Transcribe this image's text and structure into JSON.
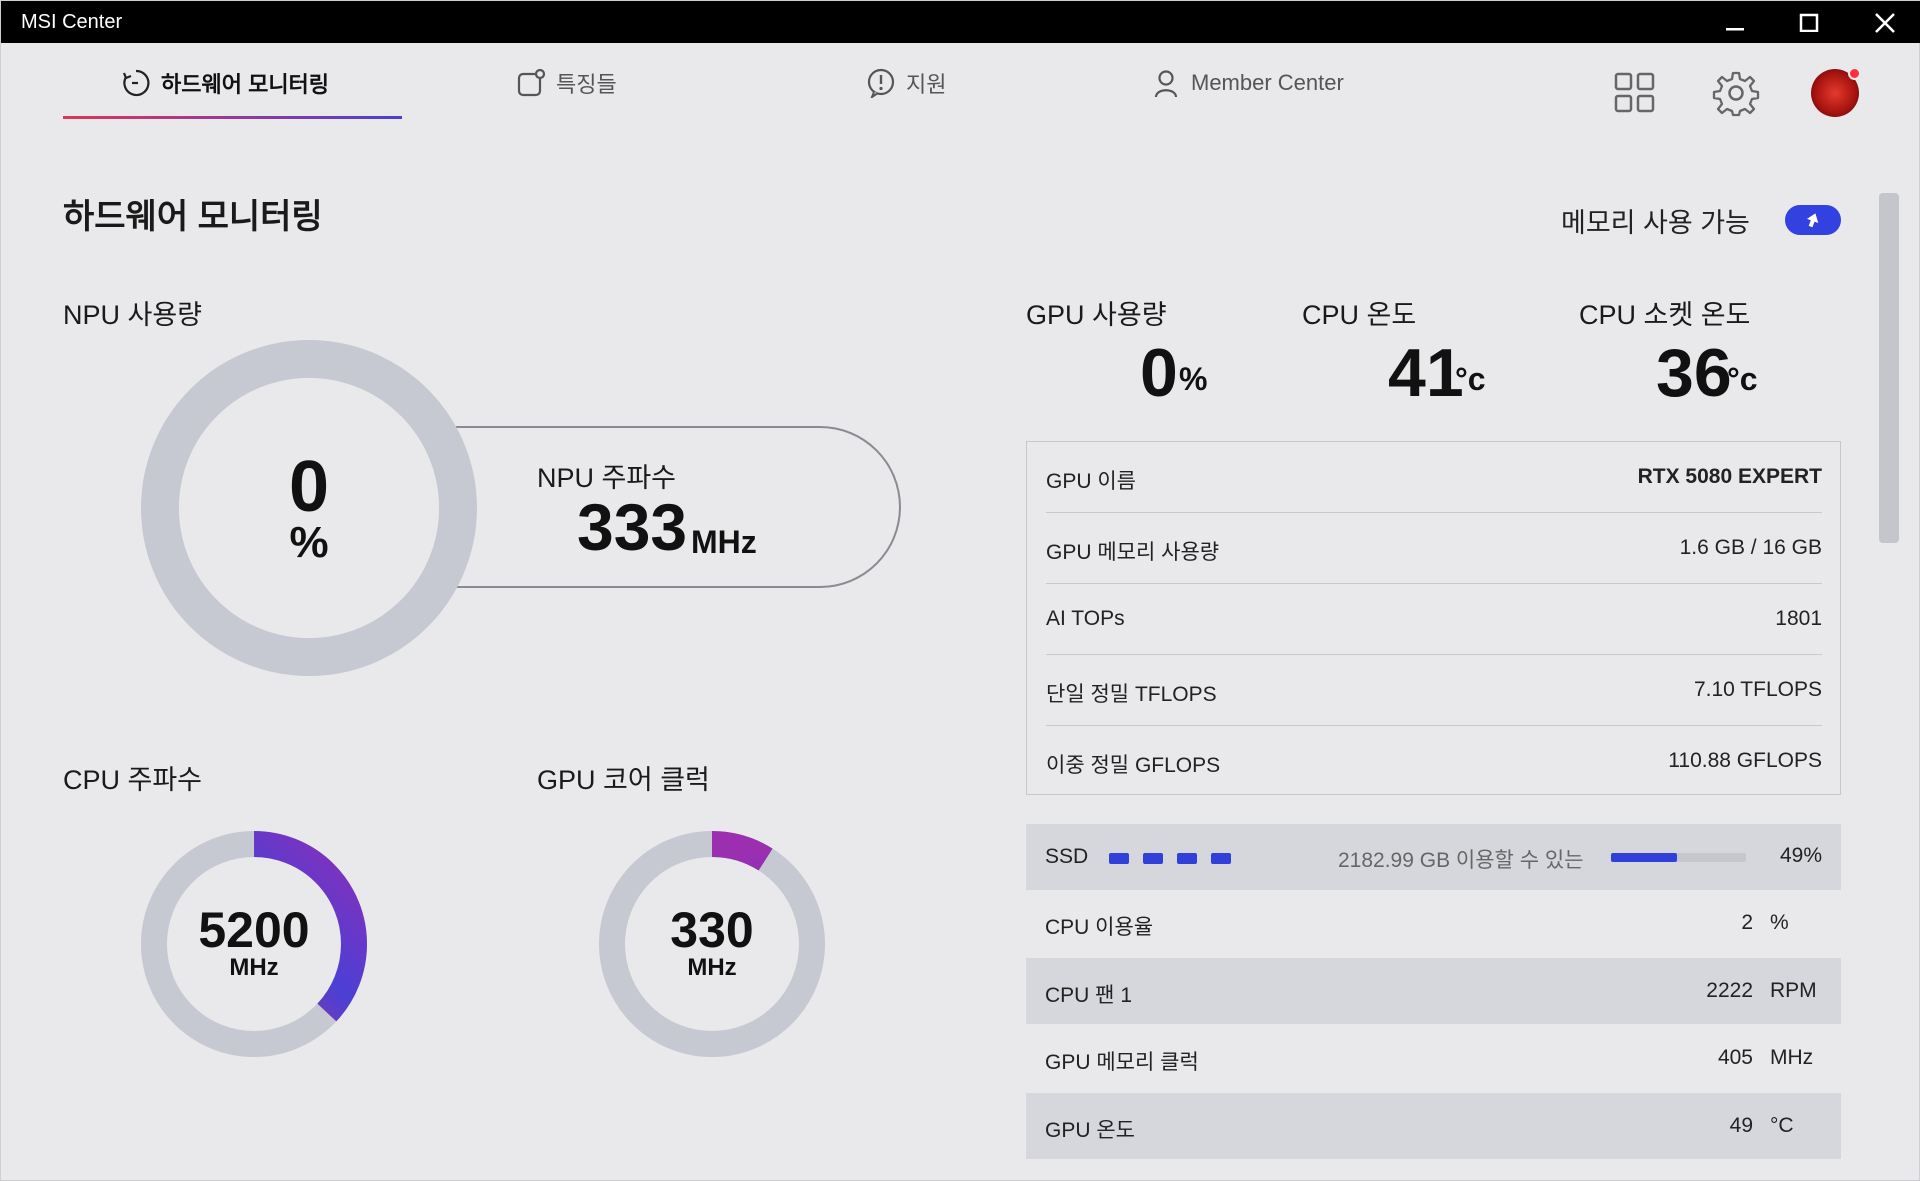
{
  "window": {
    "title": "MSI Center"
  },
  "nav": {
    "tabs": [
      {
        "label": "하드웨어 모니터링",
        "icon": "refresh-clock-icon",
        "active": true
      },
      {
        "label": "특징들",
        "icon": "feature-icon",
        "active": false
      },
      {
        "label": "지원",
        "icon": "alert-circle-icon",
        "active": false
      },
      {
        "label": "Member Center",
        "icon": "user-icon",
        "active": false
      }
    ],
    "accent_gradient": [
      "#e0345b",
      "#4b3fd6"
    ]
  },
  "page": {
    "title": "하드웨어 모니터링",
    "memory_available_label": "메모리 사용 가능",
    "memory_toggle_on": true
  },
  "npu": {
    "usage_label": "NPU 사용량",
    "usage_value": "0",
    "usage_unit": "%",
    "freq_label": "NPU 주파수",
    "freq_value": "333",
    "freq_unit": "MHz"
  },
  "cpu_freq": {
    "label": "CPU 주파수",
    "value": "5200",
    "unit": "MHz",
    "gauge_fraction": 0.37
  },
  "gpu_core": {
    "label": "GPU 코어 클럭",
    "value": "330",
    "unit": "MHz",
    "gauge_fraction": 0.09
  },
  "top_stats": [
    {
      "label": "GPU 사용량",
      "value": "0",
      "unit": "%"
    },
    {
      "label": "CPU 온도",
      "value": "41",
      "unit": "°c"
    },
    {
      "label": "CPU 소켓 온도",
      "value": "36",
      "unit": "°c"
    }
  ],
  "gpu_info": [
    {
      "key": "GPU 이름",
      "value": "RTX 5080 EXPERT"
    },
    {
      "key": "GPU 메모리 사용량",
      "value": "1.6 GB / 16 GB"
    },
    {
      "key": "AI TOPs",
      "value": "1801"
    },
    {
      "key": "단일 정밀 TFLOPS",
      "value": "7.10 TFLOPS"
    },
    {
      "key": "이중 정밀 GFLOPS",
      "value": "110.88 GFLOPS"
    }
  ],
  "ssd": {
    "label": "SSD",
    "text": "2182.99 GB 이용할 수 있는",
    "percent": "49%",
    "fraction": 0.49
  },
  "stats": [
    {
      "key": "CPU 이용율",
      "value": "2",
      "unit": "%"
    },
    {
      "key": "CPU 팬 1",
      "value": "2222",
      "unit": "RPM"
    },
    {
      "key": "GPU 메모리 클럭",
      "value": "405",
      "unit": "MHz"
    },
    {
      "key": "GPU 온도",
      "value": "49",
      "unit": "°C"
    }
  ],
  "colors": {
    "toggle": "#3341e0",
    "ssd_bar": "#3040d8",
    "gauge_track": "#c6c9d2"
  }
}
